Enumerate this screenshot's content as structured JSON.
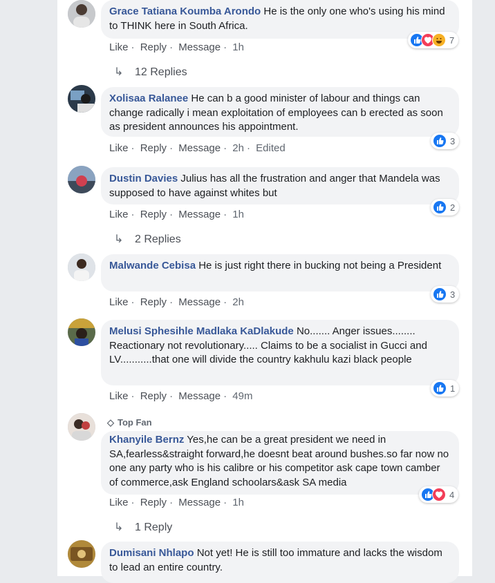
{
  "actions": {
    "like": "Like",
    "reply": "Reply",
    "message": "Message",
    "edited": "Edited"
  },
  "comments": [
    {
      "author": "Grace Tatiana Koumba Arondo",
      "text": "He is the only one who's using his mind to THINK here in South Africa.",
      "time": "1h",
      "reaction_count": "7",
      "reactions": [
        "like-icon",
        "love-icon",
        "haha-icon"
      ],
      "replies": "12 Replies"
    },
    {
      "author": "Xolisaa Ralanee",
      "text": "He can b a good minister of labour and things can change radically i mean exploitation of employees can b erected as soon as president announces his appointment.",
      "time": "2h",
      "reaction_count": "3",
      "reactions": [
        "like-icon"
      ]
    },
    {
      "author": "Dustin Davies",
      "text": "Julius has all the frustration and anger that Mandela was supposed to have against whites but",
      "time": "1h",
      "reaction_count": "2",
      "reactions": [
        "like-icon"
      ],
      "replies": "2 Replies"
    },
    {
      "author": "Malwande Cebisa",
      "text": "He is just right there in bucking not being a President",
      "time": "2h",
      "reaction_count": "3",
      "reactions": [
        "like-icon"
      ]
    },
    {
      "author": "Melusi Sphesihle Madlaka KaDlakude",
      "text": "No....... Anger issues........ Reactionary not revolutionary..... Claims to be a socialist in Gucci and LV...........that one will divide the country kakhulu kazi black people",
      "time": "49m",
      "reaction_count": "1",
      "reactions": [
        "like-icon"
      ]
    },
    {
      "badge": "Top Fan",
      "author": "Khanyile Bernz",
      "text": "Yes,he can be a great president we need in SA,fearless&straight forward,he doesnt beat around bushes.so far now no one any party who is his calibre or his competitor ask cape town camber of commerce,ask England schoolars&ask SA media",
      "time": "1h",
      "reaction_count": "4",
      "reactions": [
        "like-icon",
        "love-icon"
      ],
      "replies": "1 Reply"
    },
    {
      "author": "Dumisani Nhlapo",
      "text": "Not yet! He is still too immature and lacks the wisdom to lead an entire country."
    }
  ],
  "colors": {
    "author": "#385898",
    "bubble": "#f2f3f5",
    "like": "#1877f2",
    "love": "#f33e58",
    "haha": "#f7b125"
  }
}
